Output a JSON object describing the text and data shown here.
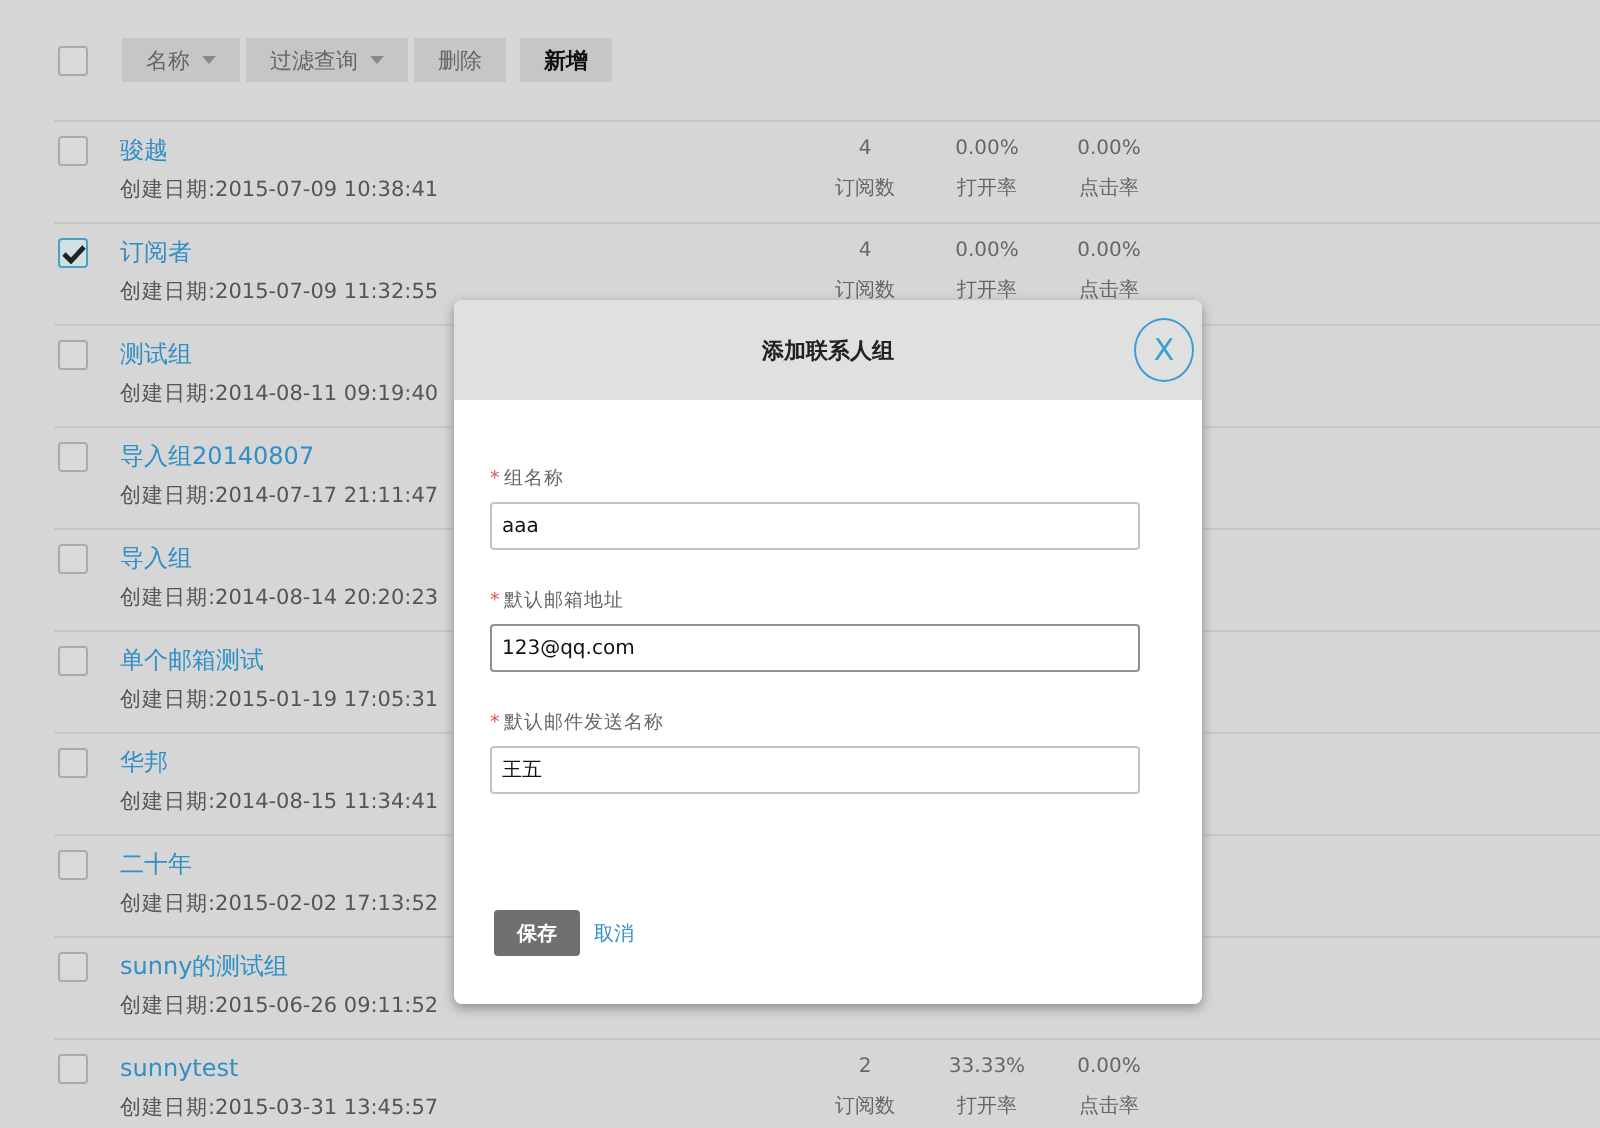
{
  "toolbar": {
    "select_all": {
      "checked": false
    },
    "buttons": [
      {
        "label": "名称",
        "kind": "dropdown"
      },
      {
        "label": "过滤查询",
        "kind": "dropdown"
      },
      {
        "label": "删除",
        "kind": "plain"
      },
      {
        "label": "新增",
        "kind": "strong"
      }
    ]
  },
  "groups": [
    {
      "name": "骏越",
      "created": "创建日期:2015-07-09 10:38:41",
      "checked": false,
      "stats": [
        {
          "value": "4",
          "label": "订阅数"
        },
        {
          "value": "0.00%",
          "label": "打开率"
        },
        {
          "value": "0.00%",
          "label": "点击率"
        }
      ]
    },
    {
      "name": "订阅者",
      "created": "创建日期:2015-07-09 11:32:55",
      "checked": true,
      "stats": [
        {
          "value": "4",
          "label": "订阅数"
        },
        {
          "value": "0.00%",
          "label": "打开率"
        },
        {
          "value": "0.00%",
          "label": "点击率"
        }
      ]
    },
    {
      "name": "测试组",
      "created": "创建日期:2014-08-11 09:19:40",
      "checked": false
    },
    {
      "name": "导入组20140807",
      "created": "创建日期:2014-07-17 21:11:47",
      "checked": false
    },
    {
      "name": "导入组",
      "created": "创建日期:2014-08-14 20:20:23",
      "checked": false
    },
    {
      "name": "单个邮箱测试",
      "created": "创建日期:2015-01-19 17:05:31",
      "checked": false
    },
    {
      "name": "华邦",
      "created": "创建日期:2014-08-15 11:34:41",
      "checked": false
    },
    {
      "name": "二十年",
      "created": "创建日期:2015-02-02 17:13:52",
      "checked": false
    },
    {
      "name": "sunny的测试组",
      "created": "创建日期:2015-06-26 09:11:52",
      "checked": false
    },
    {
      "name": "sunnytest",
      "created": "创建日期:2015-03-31 13:45:57",
      "checked": false,
      "stats": [
        {
          "value": "2",
          "label": "订阅数"
        },
        {
          "value": "33.33%",
          "label": "打开率"
        },
        {
          "value": "0.00%",
          "label": "点击率"
        }
      ]
    }
  ],
  "dialog": {
    "title": "添加联系人组",
    "close_icon": "X",
    "fields": [
      {
        "label": "组名称",
        "required_mark": "*",
        "value": "aaa",
        "focused": false
      },
      {
        "label": "默认邮箱地址",
        "required_mark": "*",
        "value": "123@qq.com",
        "focused": true
      },
      {
        "label": "默认邮件发送名称",
        "required_mark": "*",
        "value": "王五",
        "focused": false
      }
    ],
    "save": "保存",
    "cancel": "取消"
  }
}
